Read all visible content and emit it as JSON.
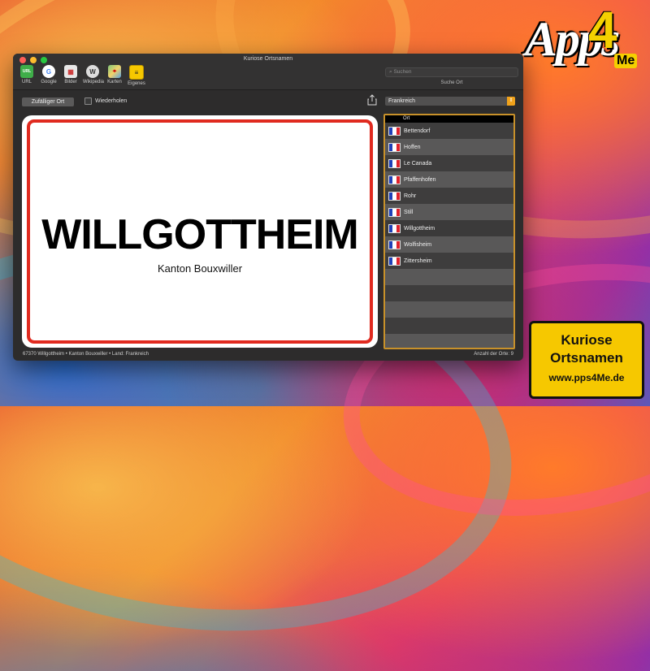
{
  "window": {
    "title": "Kuriose Ortsnamen"
  },
  "toolbar": {
    "items": [
      {
        "label": "URL",
        "icon": "url-icon",
        "glyph": "URL"
      },
      {
        "label": "Google",
        "icon": "google-icon",
        "glyph": "G"
      },
      {
        "label": "Bilder",
        "icon": "pictures-icon",
        "glyph": "▦"
      },
      {
        "label": "Wikipedia",
        "icon": "wikipedia-icon",
        "glyph": "W"
      },
      {
        "label": "Karten",
        "icon": "map-icon",
        "glyph": "⌖"
      },
      {
        "label": "Eigenes",
        "icon": "custom-icon",
        "glyph": "≡"
      }
    ]
  },
  "search": {
    "placeholder": "Suchen",
    "label": "Suche Ort"
  },
  "controls": {
    "random_label": "Zufälliger Ort",
    "repeat_label": "Wiederholen",
    "country": "Frankreich"
  },
  "sign": {
    "name": "WILLGOTTHEIM",
    "subtitle": "Kanton Bouxwiller"
  },
  "list": {
    "header": "Ort",
    "items": [
      "Bettendorf",
      "Hoffen",
      "Le Canada",
      "Pfaffenhofen",
      "Rohr",
      "Still",
      "Willgottheim",
      "Wolfisheim",
      "Zittersheim"
    ]
  },
  "status": {
    "left": "67370 Willgottheim • Kanton Bouxwiller • Land: Frankreich",
    "right": "Anzahl der Orte: 9"
  },
  "promo": {
    "line1": "Kuriose",
    "line2": "Ortsnamen",
    "url": "www.pps4Me.de"
  },
  "logo": {
    "text": "Apps",
    "number": "4",
    "suffix": "Me"
  },
  "colors": {
    "sign_border": "#e02a1f",
    "list_border": "#c8912a",
    "promo_bg": "#f6c800",
    "accent": "#f0a21b"
  }
}
